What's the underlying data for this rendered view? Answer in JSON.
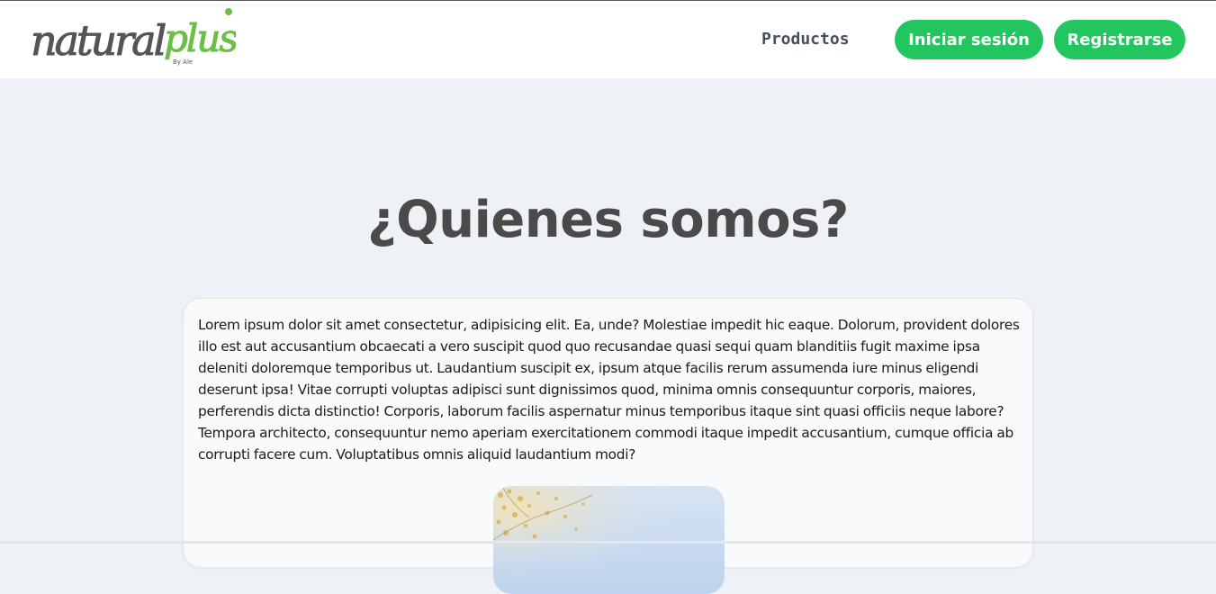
{
  "brand": {
    "logo_primary": "natural",
    "logo_accent": "plus",
    "logo_byline": "By Ale",
    "accent_color": "#22c55e",
    "logo_green": "#6abf45",
    "logo_gray": "#555555"
  },
  "nav": {
    "products_label": "Productos",
    "login_label": "Iniciar sesión",
    "register_label": "Registrarse"
  },
  "main": {
    "title": "¿Quienes somos?",
    "body": "Lorem ipsum dolor sit amet consectetur, adipisicing elit. Ea, unde? Molestiae impedit hic eaque. Dolorum, provident dolores illo est aut accusantium obcaecati a vero suscipit quod quo recusandae quasi sequi quam blanditiis fugit maxime ipsa deleniti doloremque temporibus ut. Laudantium suscipit ex, ipsum atque facilis rerum assumenda iure minus eligendi deserunt ipsa! Vitae corrupti voluptas adipisci sunt dignissimos quod, minima omnis consequuntur corporis, maiores, perferendis dicta distinctio! Corporis, laborum facilis aspernatur minus temporibus itaque sint quasi officiis neque labore? Tempora architecto, consequuntur nemo aperiam exercitationem commodi itaque impedit accusantium, cumque officia ab corrupti facere cum. Voluptatibus omnis aliquid laudantium modi?"
  }
}
